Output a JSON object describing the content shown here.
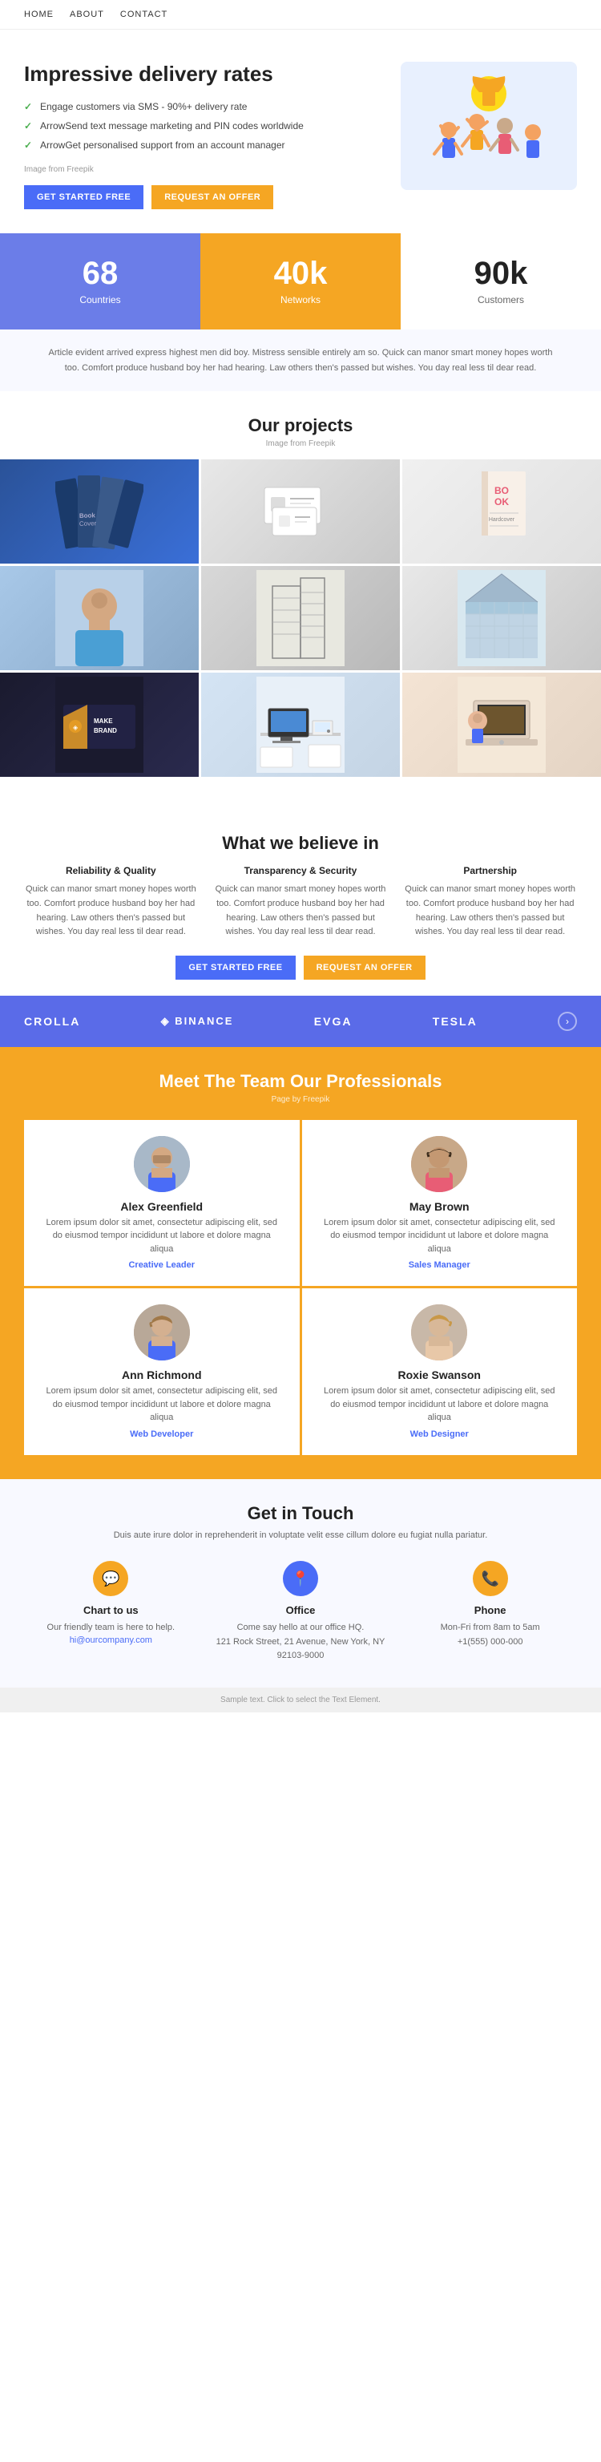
{
  "nav": {
    "items": [
      "Home",
      "About",
      "Contact"
    ]
  },
  "hero": {
    "title": "Impressive delivery rates",
    "list": [
      "Engage customers via SMS - 90%+ delivery rate",
      "ArrowSend text message marketing and PIN codes worldwide",
      "ArrowGet personalised support from an account manager"
    ],
    "image_ref": "Image from Freepik",
    "btn_started": "GET STARTED FREE",
    "btn_offer": "REQUEST AN OFFER"
  },
  "stats": [
    {
      "number": "68",
      "label": "Countries",
      "style": "blue"
    },
    {
      "number": "40k",
      "label": "Networks",
      "style": "orange"
    },
    {
      "number": "90k",
      "label": "Customers",
      "style": "white"
    }
  ],
  "article": {
    "text": "Article evident arrived express highest men did boy. Mistress sensible entirely am so. Quick can manor smart money hopes worth too. Comfort produce husband boy her had hearing. Law others then's passed but wishes. You day real less til dear read."
  },
  "projects": {
    "title": "Our projects",
    "subtitle": "Image from Freepik"
  },
  "beliefs": {
    "title": "What we believe in",
    "items": [
      {
        "title": "Reliability & Quality",
        "text": "Quick can manor smart money hopes worth too. Comfort produce husband boy her had hearing. Law others then's passed but wishes. You day real less til dear read."
      },
      {
        "title": "Transparency & Security",
        "text": "Quick can manor smart money hopes worth too. Comfort produce husband boy her had hearing. Law others then's passed but wishes. You day real less til dear read."
      },
      {
        "title": "Partnership",
        "text": "Quick can manor smart money hopes worth too. Comfort produce husband boy her had hearing. Law others then's passed but wishes. You day real less til dear read."
      }
    ],
    "btn_started": "GET STARTED FREE",
    "btn_offer": "REQUEST AN OFFER"
  },
  "brands": {
    "logos": [
      "CROLLA",
      "◈ BINANCE",
      "EVGA",
      "TESLA"
    ]
  },
  "team": {
    "title": "Meet The Team Our Professionals",
    "subtitle": "Page by Freepik",
    "members": [
      {
        "name": "Alex Greenfield",
        "desc": "Lorem ipsum dolor sit amet, consectetur adipiscing elit, sed do eiusmod tempor incididunt ut labore et dolore magna aliqua",
        "role": "Creative Leader"
      },
      {
        "name": "May Brown",
        "desc": "Lorem ipsum dolor sit amet, consectetur adipiscing elit, sed do eiusmod tempor incididunt ut labore et dolore magna aliqua",
        "role": "Sales Manager"
      },
      {
        "name": "Ann Richmond",
        "desc": "Lorem ipsum dolor sit amet, consectetur adipiscing elit, sed do eiusmod tempor incididunt ut labore et dolore magna aliqua",
        "role": "Web Developer"
      },
      {
        "name": "Roxie Swanson",
        "desc": "Lorem ipsum dolor sit amet, consectetur adipiscing elit, sed do eiusmod tempor incididunt ut labore et dolore magna aliqua",
        "role": "Web Designer"
      }
    ]
  },
  "contact": {
    "title": "Get in Touch",
    "subtitle": "Duis aute irure dolor in reprehenderit in voluptate velit esse cillum dolore eu fugiat nulla pariatur.",
    "items": [
      {
        "icon": "💬",
        "label": "Chart to us",
        "detail": "Our friendly team is here to help.",
        "link": "hi@ourcompany.com",
        "icon_style": "chat"
      },
      {
        "icon": "📍",
        "label": "Office",
        "detail": "Come say hello at our office HQ.",
        "address": "121 Rock Street, 21 Avenue,\nNew York, NY 92103-9000",
        "icon_style": "office"
      },
      {
        "icon": "📞",
        "label": "Phone",
        "detail": "Mon-Fri from 8am to 5am",
        "phone": "+1(555) 000-000",
        "icon_style": "phone"
      }
    ]
  },
  "footer": {
    "text": "Sample text. Click to select the Text Element."
  }
}
